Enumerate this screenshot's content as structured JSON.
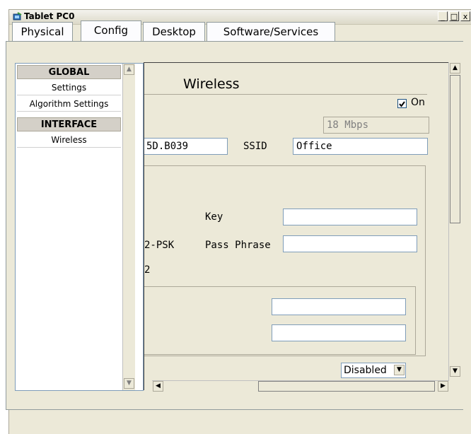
{
  "window": {
    "title": "Tablet PC0",
    "minimize": "_",
    "maximize": "□",
    "close": "x"
  },
  "tabs": [
    {
      "label": "Physical"
    },
    {
      "label": "Config"
    },
    {
      "label": "Desktop"
    },
    {
      "label": "Software/Services"
    }
  ],
  "nav": {
    "global_header": "GLOBAL",
    "settings": "Settings",
    "algorithm_settings": "Algorithm Settings",
    "interface_header": "INTERFACE",
    "wireless": "Wireless"
  },
  "wireless": {
    "heading": "Wireless",
    "port_status_label": "On",
    "port_status_checked": true,
    "bandwidth": "18 Mbps",
    "mac_fragment": "5D.B039",
    "ssid_label": "SSID",
    "ssid_value": "Office",
    "key_label": "Key",
    "key_value": "",
    "psk_fragment": "2-PSK",
    "pass_phrase_label": "Pass Phrase",
    "pass_phrase_value": "",
    "fragment_2": "2",
    "box_field_1": "",
    "box_field_2": "",
    "encryption_select": "Disabled"
  }
}
